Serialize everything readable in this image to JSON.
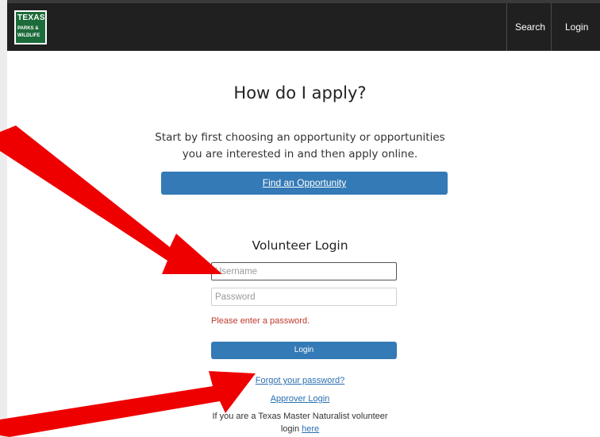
{
  "header": {
    "logo": {
      "line1": "TEXAS",
      "line2": "PARKS &",
      "line3": "WILDLIFE"
    },
    "nav": {
      "search": "Search",
      "login": "Login"
    }
  },
  "main": {
    "title": "How do I apply?",
    "intro_line1": "Start by first choosing an opportunity or opportunities",
    "intro_line2": "you are interested in and then apply online.",
    "find_button": "Find an Opportunity"
  },
  "login": {
    "title": "Volunteer Login",
    "username_placeholder": "Username",
    "password_placeholder": "Password",
    "error": "Please enter a password.",
    "login_button": "Login",
    "forgot_link": "Forgot your password?",
    "approver_link": "Approver Login",
    "naturalist_text": "If you are a Texas Master Naturalist volunteer",
    "naturalist_text2": "login",
    "naturalist_link": "here"
  },
  "annotations": {
    "arrow_color": "#ee0000"
  }
}
